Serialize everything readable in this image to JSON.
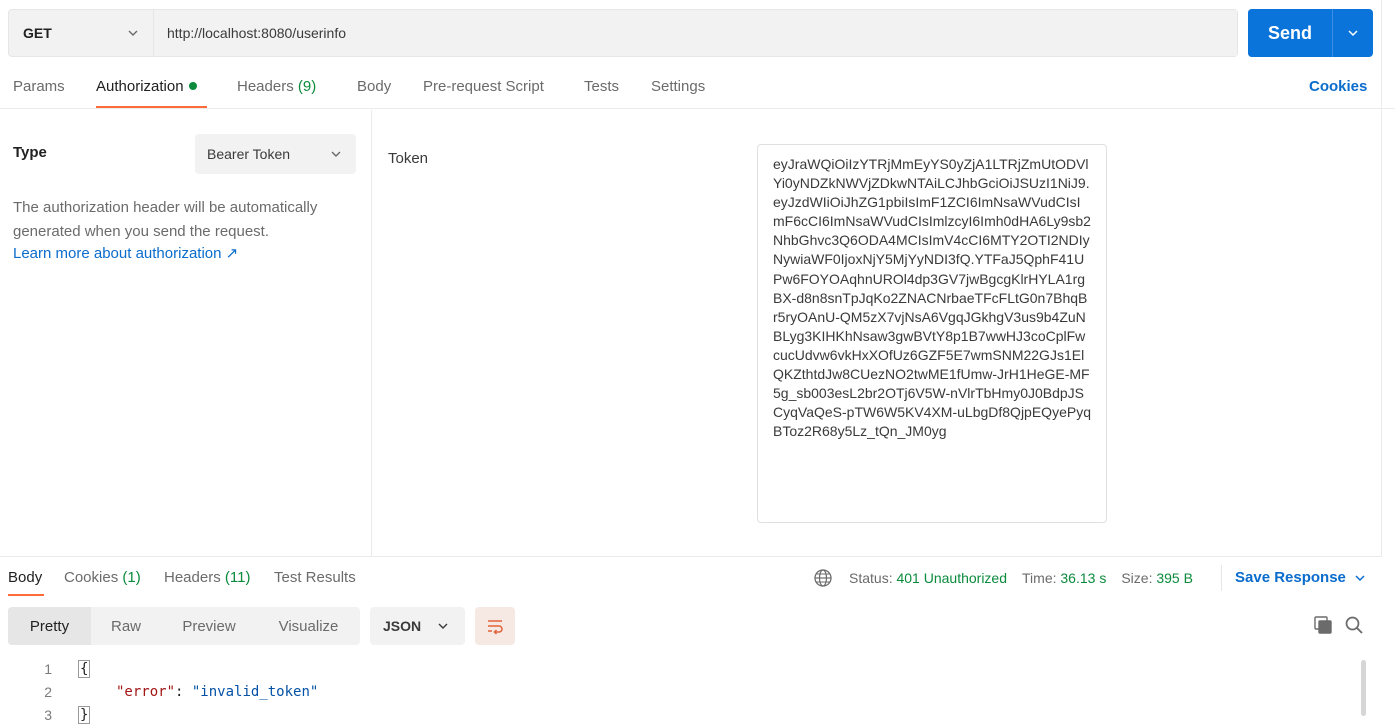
{
  "request": {
    "method": "GET",
    "url": "http://localhost:8080/userinfo",
    "send_label": "Send"
  },
  "tabs": {
    "params": "Params",
    "authorization": "Authorization",
    "headers": "Headers",
    "headers_count": "(9)",
    "body": "Body",
    "prerequest": "Pre-request Script",
    "tests": "Tests",
    "settings": "Settings",
    "cookies": "Cookies"
  },
  "auth": {
    "type_label": "Type",
    "type_value": "Bearer Token",
    "description": "The authorization header will be automatically generated when you send the request.",
    "learn_more": "Learn more about authorization ↗",
    "token_label": "Token",
    "token_value": "eyJraWQiOiIzYTRjMmEyYS0yZjA1LTRjZmUtODVlYi0yNDZkNWVjZDkwNTAiLCJhbGciOiJSUzI1NiJ9.eyJzdWIiOiJhZG1pbiIsImF1ZCI6ImNsaWVudCIsImF6cCI6ImNsaWVudCIsImlzcyI6Imh0dHA6Ly9sb2NhbGhvc3Q6ODA4MCIsImV4cCI6MTY2OTI2NDIyNywiaWF0IjoxNjY5MjYyNDI3fQ.YTFaJ5QphF41UPw6FOYOAqhnUROl4dp3GV7jwBgcgKlrHYLA1rgBX-d8n8snTpJqKo2ZNACNrbaeTFcFLtG0n7BhqBr5ryOAnU-QM5zX7vjNsA6VgqJGkhgV3us9b4ZuNBLyg3KIHKhNsaw3gwBVtY8p1B7wwHJ3coCplFwcucUdvw6vkHxXOfUz6GZF5E7wmSNM22GJs1ElQKZthtdJw8CUezNO2twME1fUmw-JrH1HeGE-MF5g_sb003esL2br2OTj6V5W-nVlrTbHmy0J0BdpJSCyqVaQeS-pTW6W5KV4XM-uLbgDf8QjpEQyePyqBToz2R68y5Lz_tQn_JM0yg"
  },
  "response": {
    "tabs": {
      "body": "Body",
      "cookies": "Cookies",
      "cookies_count": "(1)",
      "headers": "Headers",
      "headers_count": "(11)",
      "test_results": "Test Results"
    },
    "status_label": "Status:",
    "status_value": "401 Unauthorized",
    "time_label": "Time:",
    "time_value": "36.13 s",
    "size_label": "Size:",
    "size_value": "395 B",
    "save_response": "Save Response",
    "view_modes": [
      "Pretty",
      "Raw",
      "Preview",
      "Visualize"
    ],
    "format": "JSON",
    "code_lines": [
      {
        "num": "1",
        "open": "{"
      },
      {
        "num": "2",
        "key": "\"error\"",
        "colon": ": ",
        "value": "\"invalid_token\""
      },
      {
        "num": "3",
        "close": "}"
      }
    ]
  },
  "colors": {
    "accent": "#0a74da",
    "active_tab": "#ff6c37",
    "status_ok": "#0b8a3c",
    "link": "#0a6ccc"
  }
}
